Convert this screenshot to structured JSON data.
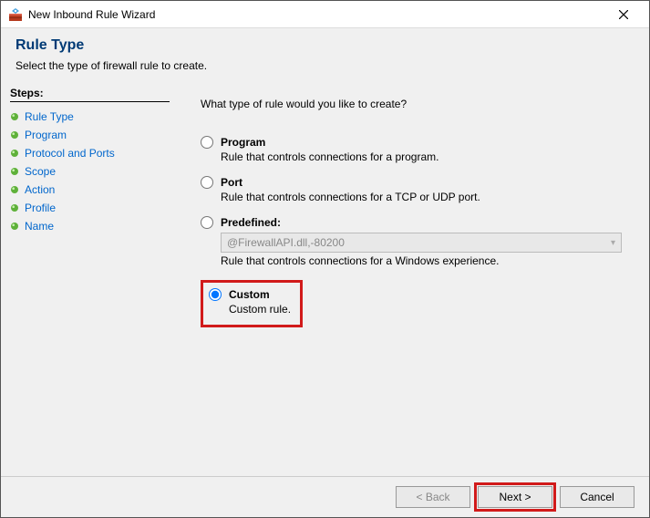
{
  "window": {
    "title": "New Inbound Rule Wizard"
  },
  "header": {
    "title": "Rule Type",
    "subtitle": "Select the type of firewall rule to create."
  },
  "steps": {
    "title": "Steps:",
    "items": [
      {
        "label": "Rule Type"
      },
      {
        "label": "Program"
      },
      {
        "label": "Protocol and Ports"
      },
      {
        "label": "Scope"
      },
      {
        "label": "Action"
      },
      {
        "label": "Profile"
      },
      {
        "label": "Name"
      }
    ]
  },
  "main": {
    "question": "What type of rule would you like to create?",
    "options": {
      "program": {
        "label": "Program",
        "desc": "Rule that controls connections for a program."
      },
      "port": {
        "label": "Port",
        "desc": "Rule that controls connections for a TCP or UDP port."
      },
      "predefined": {
        "label": "Predefined:",
        "select_value": "@FirewallAPI.dll,-80200",
        "desc": "Rule that controls connections for a Windows experience."
      },
      "custom": {
        "label": "Custom",
        "desc": "Custom rule."
      }
    }
  },
  "footer": {
    "back": "< Back",
    "next": "Next >",
    "cancel": "Cancel"
  }
}
